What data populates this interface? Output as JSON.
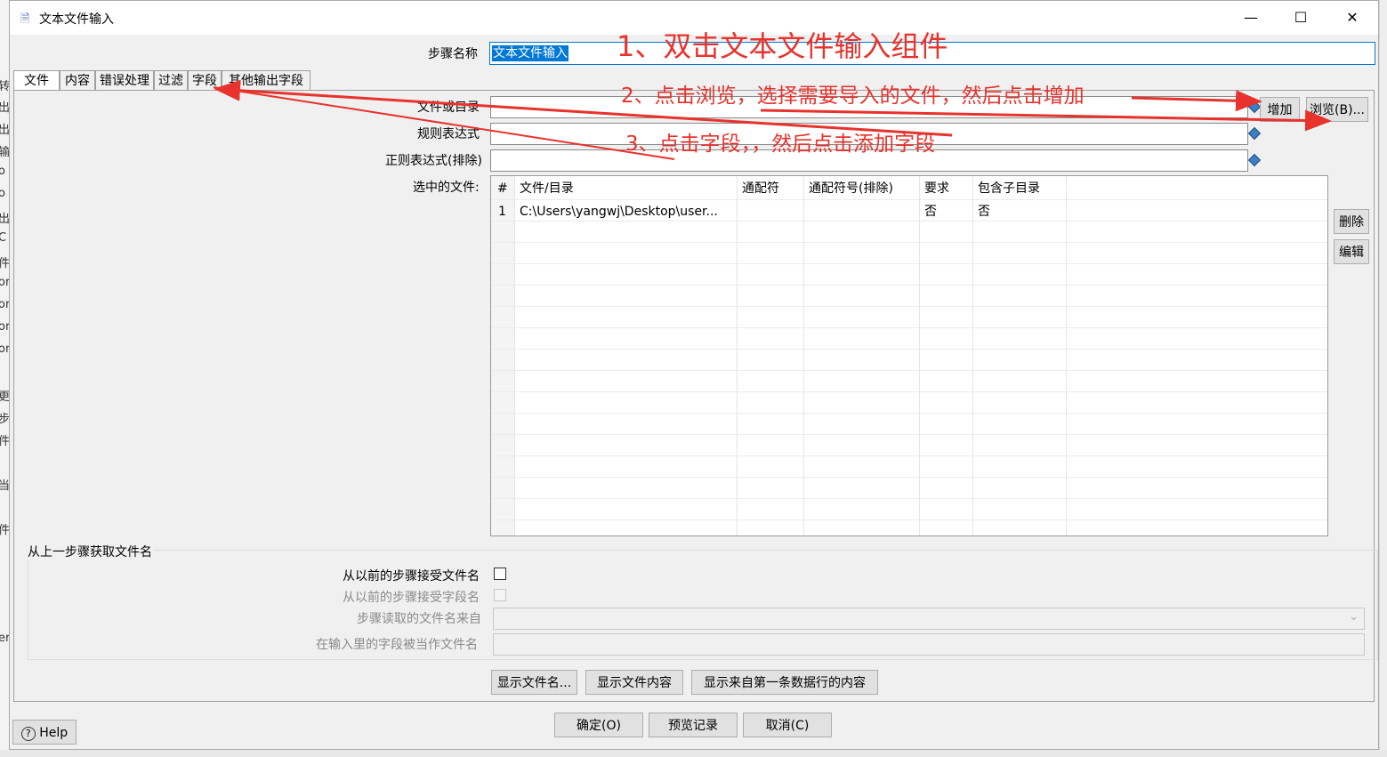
{
  "window": {
    "title": "文本文件输入",
    "controls": {
      "minimize": "—",
      "maximize": "☐",
      "close": "✕"
    }
  },
  "step_name": {
    "label": "步骤名称",
    "value": "文本文件输入"
  },
  "tabs": [
    "文件",
    "内容",
    "错误处理",
    "过滤",
    "字段",
    "其他输出字段"
  ],
  "file_tab": {
    "file_or_dir_label": "文件或目录",
    "regex_label": "规则表达式",
    "regex_exclude_label": "正则表达式(排除)",
    "selected_files_label": "选中的文件:",
    "add_button": "增加",
    "browse_button": "浏览(B)...",
    "delete_button": "删除",
    "edit_button": "编辑",
    "table": {
      "headers": [
        "#",
        "文件/目录",
        "通配符",
        "通配符号(排除)",
        "要求",
        "包含子目录"
      ],
      "rows": [
        [
          "1",
          "C:\\Users\\yangwj\\Desktop\\user...",
          "",
          "",
          "否",
          "否"
        ]
      ]
    },
    "group": {
      "title": "从上一步骤获取文件名",
      "accept_filenames_label": "从以前的步骤接受文件名",
      "accept_fieldnames_label": "从以前的步骤接受字段名",
      "step_source_label": "步骤读取的文件名来自",
      "field_as_filename_label": "在输入里的字段被当作文件名"
    },
    "show_filenames_button": "显示文件名...",
    "show_file_content_button": "显示文件内容",
    "show_first_row_button": "显示来自第一条数据行的内容"
  },
  "footer": {
    "ok_button": "确定(O)",
    "preview_button": "预览记录",
    "cancel_button": "取消(C)",
    "help_button": "Help"
  },
  "annotations": {
    "step1": "1、双击文本文件输入组件",
    "step2": "2、点击浏览，选择需要导入的文件，然后点击增加",
    "step3": "3、点击字段，，然后点击添加字段"
  },
  "background_fragments": [
    "转",
    "出",
    "出",
    "输",
    "o",
    "o",
    "出",
    "C",
    "件",
    "or",
    "or",
    "or",
    "or",
    "更",
    "步",
    "件",
    "当",
    "件",
    "er"
  ],
  "colors": {
    "annotation": "#e8322c",
    "selection": "#0078d7"
  }
}
